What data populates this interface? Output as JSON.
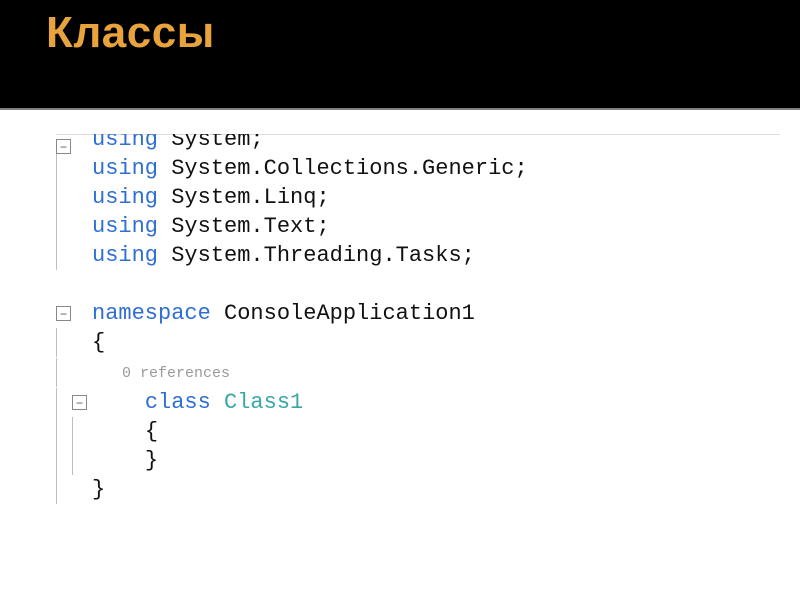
{
  "slide": {
    "title": "Классы"
  },
  "code": {
    "lines": [
      {
        "indent": 0,
        "tokens": [
          {
            "t": "kw",
            "v": "using"
          },
          {
            "t": "plain",
            "v": " System;"
          }
        ],
        "outline": "minus",
        "cut": true
      },
      {
        "indent": 0,
        "tokens": [
          {
            "t": "kw",
            "v": "using"
          },
          {
            "t": "plain",
            "v": " System.Collections.Generic;"
          }
        ],
        "outline": "rail"
      },
      {
        "indent": 0,
        "tokens": [
          {
            "t": "kw",
            "v": "using"
          },
          {
            "t": "plain",
            "v": " System.Linq;"
          }
        ],
        "outline": "rail"
      },
      {
        "indent": 0,
        "tokens": [
          {
            "t": "kw",
            "v": "using"
          },
          {
            "t": "plain",
            "v": " System.Text;"
          }
        ],
        "outline": "rail"
      },
      {
        "indent": 0,
        "tokens": [
          {
            "t": "kw",
            "v": "using"
          },
          {
            "t": "plain",
            "v": " System.Threading.Tasks;"
          }
        ],
        "outline": "rail"
      },
      {
        "blank": true
      },
      {
        "indent": 0,
        "tokens": [
          {
            "t": "kw",
            "v": "namespace"
          },
          {
            "t": "plain",
            "v": " ConsoleApplication1"
          }
        ],
        "outline": "minus"
      },
      {
        "indent": 0,
        "tokens": [
          {
            "t": "plain",
            "v": "{"
          }
        ],
        "outline": "rail"
      },
      {
        "refs": "0 references",
        "outline": "rail"
      },
      {
        "indent": 1,
        "tokens": [
          {
            "t": "kw",
            "v": "class"
          },
          {
            "t": "plain",
            "v": " "
          },
          {
            "t": "type",
            "v": "Class1"
          }
        ],
        "outline": "minus-nested"
      },
      {
        "indent": 1,
        "tokens": [
          {
            "t": "plain",
            "v": "{"
          }
        ],
        "outline": "rail-double"
      },
      {
        "indent": 1,
        "tokens": [
          {
            "t": "plain",
            "v": "}"
          }
        ],
        "outline": "rail-double"
      },
      {
        "indent": 0,
        "tokens": [
          {
            "t": "plain",
            "v": "}"
          }
        ],
        "outline": "rail"
      }
    ]
  }
}
